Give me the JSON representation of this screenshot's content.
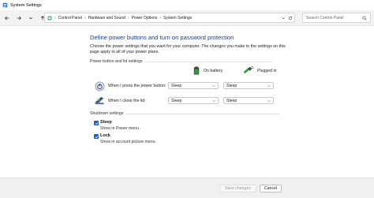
{
  "window": {
    "title": "System Settings"
  },
  "address_bar": {
    "crumbs": [
      "Control Panel",
      "Hardware and Sound",
      "Power Options",
      "System Settings"
    ]
  },
  "search": {
    "placeholder": "Search Control Panel"
  },
  "page": {
    "title": "Define power buttons and turn on password protection",
    "intro": "Choose the power settings that you want for your computer. The changes you make to the settings on this page apply to all of your power plans."
  },
  "power_section": {
    "heading": "Power button and lid settings",
    "col_battery": "On battery",
    "col_plugged": "Plugged in",
    "rows": [
      {
        "label": "When I press the power button:",
        "battery": "Sleep",
        "plugged": "Sleep"
      },
      {
        "label": "When I close the lid:",
        "battery": "Sleep",
        "plugged": "Sleep"
      }
    ]
  },
  "shutdown_section": {
    "heading": "Shutdown settings",
    "items": [
      {
        "label": "Sleep",
        "desc": "Show in Power menu.",
        "checked": true
      },
      {
        "label": "Lock",
        "desc": "Show in account picture menu.",
        "checked": true
      }
    ]
  },
  "footer": {
    "save_label": "Save changes",
    "cancel_label": "Cancel"
  },
  "colors": {
    "title_blue": "#1e3c8c",
    "checkbox_blue": "#1d5fc4",
    "battery_green": "#2e9e3a"
  }
}
